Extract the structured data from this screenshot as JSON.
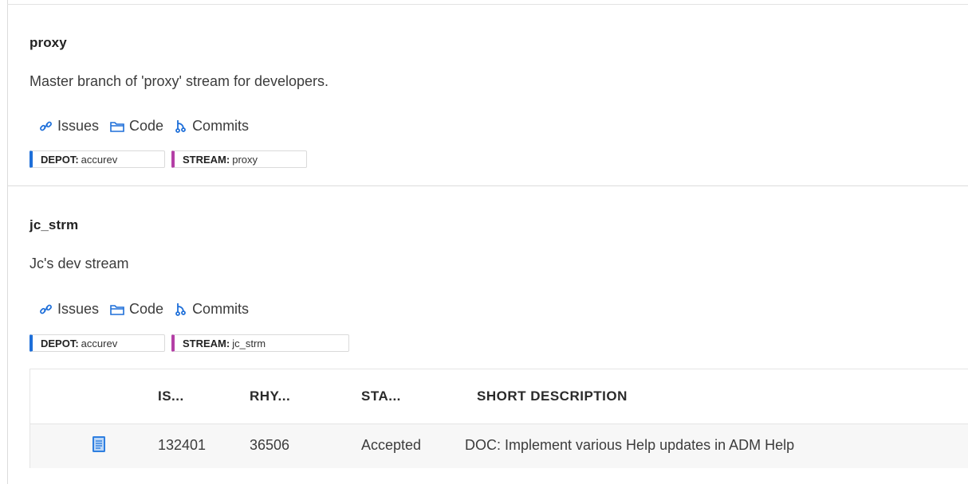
{
  "streams": [
    {
      "title": "proxy",
      "description": "Master branch of 'proxy' stream for developers.",
      "links": {
        "issues": "Issues",
        "code": "Code",
        "commits": "Commits"
      },
      "depot_label": "DEPOT:",
      "depot_value": "accurev",
      "stream_label": "STREAM:",
      "stream_value": "proxy"
    },
    {
      "title": "jc_strm",
      "description": "Jc's dev stream",
      "links": {
        "issues": "Issues",
        "code": "Code",
        "commits": "Commits"
      },
      "depot_label": "DEPOT:",
      "depot_value": "accurev",
      "stream_label": "STREAM:",
      "stream_value": "jc_strm"
    }
  ],
  "issues_table": {
    "headers": [
      "IS...",
      "RHY...",
      "STA...",
      "SHORT DESCRIPTION"
    ],
    "rows": [
      {
        "icon": "issue-document-icon",
        "issue": "132401",
        "rhy": "36506",
        "status": "Accepted",
        "description": "DOC: Implement various Help updates in ADM Help"
      }
    ]
  },
  "colors": {
    "depot_accent": "#1e6fd9",
    "stream_accent": "#b43fa6",
    "icon_blue": "#1e6fd9"
  }
}
